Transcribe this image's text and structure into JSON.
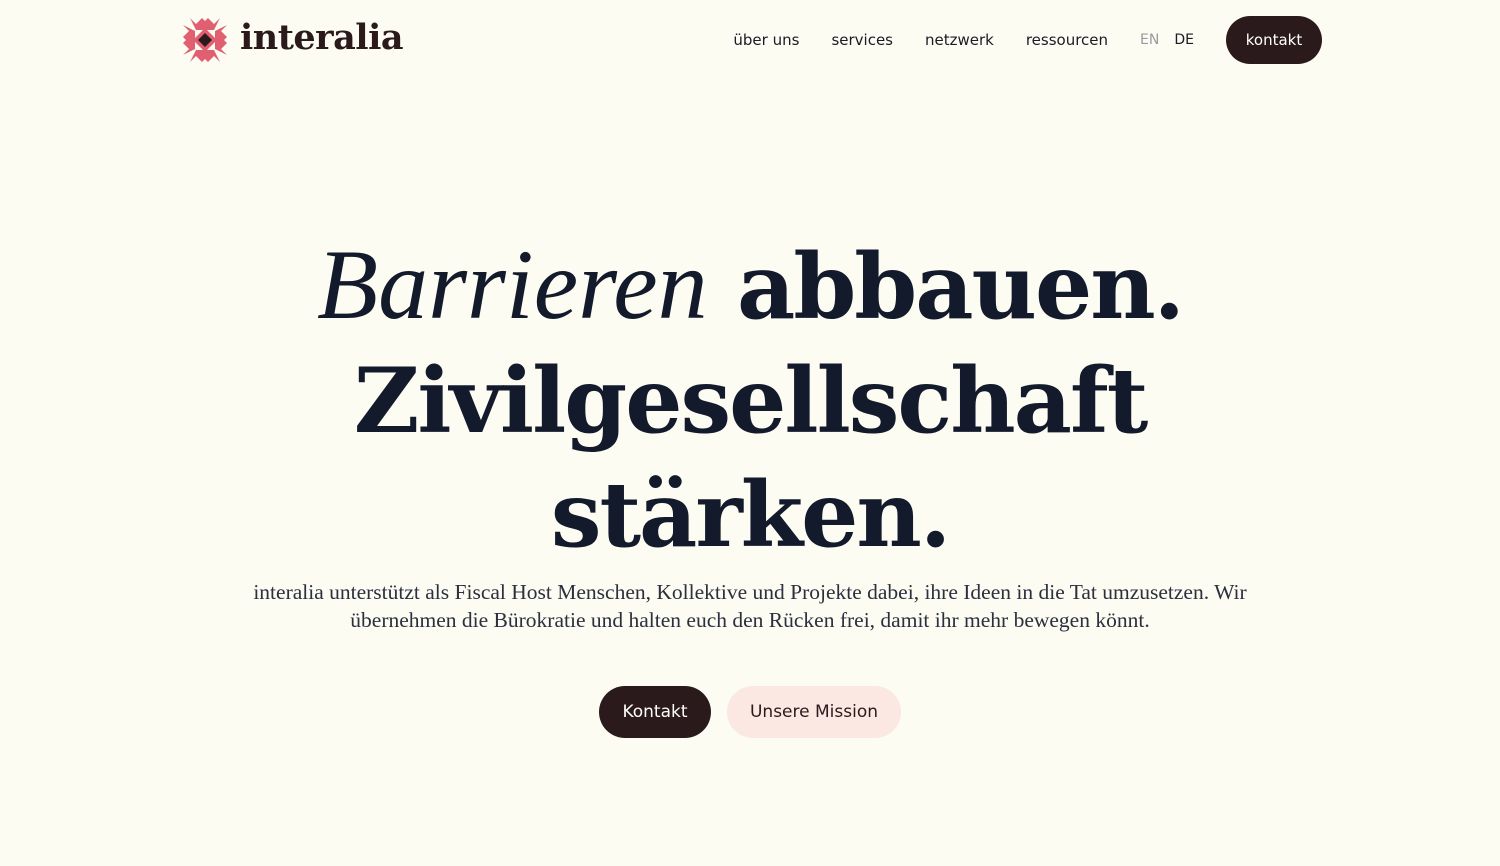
{
  "brand": {
    "name": "interalia",
    "colors": {
      "petal": "#e06072",
      "center": "#2b1a1c",
      "accent_dark": "#2b1a1c",
      "accent_light": "#fbe8e3",
      "background": "#fdfcf3"
    }
  },
  "nav": {
    "items": [
      {
        "label": "über uns"
      },
      {
        "label": "services"
      },
      {
        "label": "netzwerk"
      },
      {
        "label": "ressourcen"
      }
    ],
    "languages": {
      "en": "EN",
      "de": "DE",
      "active": "DE"
    },
    "cta_label": "kontakt"
  },
  "hero": {
    "headline_italic": "Barrieren",
    "headline_rest_1": "abbauen.",
    "headline_line_2": "Zivilgesellschaft",
    "headline_line_3": "stärken.",
    "intro": "interalia unterstützt als Fiscal Host Menschen, Kollektive und Projekte dabei, ihre Ideen in die Tat umzusetzen. Wir übernehmen die Bürokratie und halten euch den Rücken frei, damit ihr mehr bewegen könnt.",
    "primary_button": "Kontakt",
    "secondary_button": "Unsere Mission"
  }
}
